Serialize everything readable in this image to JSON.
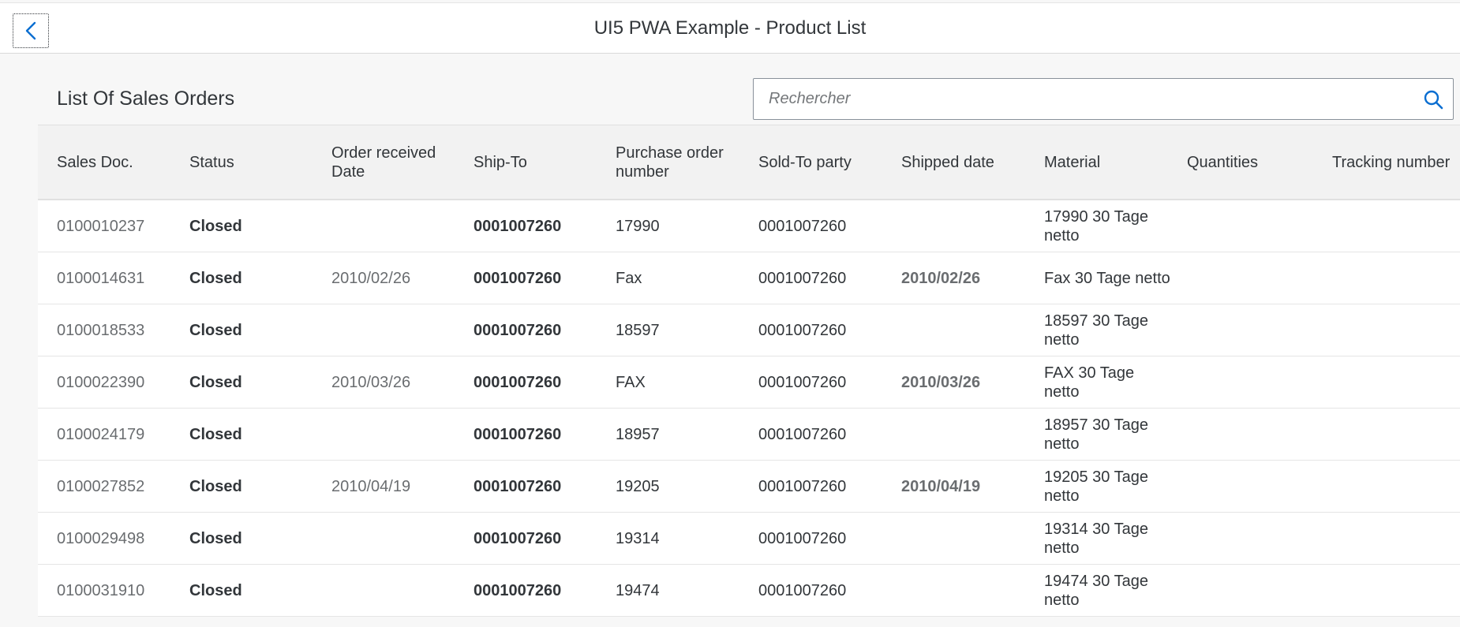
{
  "shell": {
    "title": "UI5 PWA Example - Product List",
    "back_icon": "chevron-left-icon"
  },
  "toolbar": {
    "title": "List Of Sales Orders",
    "search_placeholder": "Rechercher",
    "search_value": "",
    "search_icon": "search-icon"
  },
  "colors": {
    "accent": "#0a6ed1",
    "header_bg": "#f2f2f2",
    "page_bg": "#f7f7f7"
  },
  "table": {
    "columns": [
      "Sales Doc.",
      "Status",
      "Order received Date",
      "Ship-To",
      "Purchase order number",
      "Sold-To party",
      "Shipped date",
      "Material",
      "Quantities",
      "Tracking number"
    ],
    "rows": [
      {
        "sales_doc": "0100010237",
        "status": "Closed",
        "order_date": "",
        "ship_to": "0001007260",
        "po_number": "17990",
        "sold_to": "0001007260",
        "shipped_date": "",
        "material": "17990 30 Tage netto",
        "quantities": "",
        "tracking": ""
      },
      {
        "sales_doc": "0100014631",
        "status": "Closed",
        "order_date": "2010/02/26",
        "ship_to": "0001007260",
        "po_number": "Fax",
        "sold_to": "0001007260",
        "shipped_date": "2010/02/26",
        "material": "Fax 30 Tage netto",
        "quantities": "",
        "tracking": ""
      },
      {
        "sales_doc": "0100018533",
        "status": "Closed",
        "order_date": "",
        "ship_to": "0001007260",
        "po_number": "18597",
        "sold_to": "0001007260",
        "shipped_date": "",
        "material": "18597 30 Tage netto",
        "quantities": "",
        "tracking": ""
      },
      {
        "sales_doc": "0100022390",
        "status": "Closed",
        "order_date": "2010/03/26",
        "ship_to": "0001007260",
        "po_number": "FAX",
        "sold_to": "0001007260",
        "shipped_date": "2010/03/26",
        "material": "FAX 30 Tage netto",
        "quantities": "",
        "tracking": ""
      },
      {
        "sales_doc": "0100024179",
        "status": "Closed",
        "order_date": "",
        "ship_to": "0001007260",
        "po_number": "18957",
        "sold_to": "0001007260",
        "shipped_date": "",
        "material": "18957 30 Tage netto",
        "quantities": "",
        "tracking": ""
      },
      {
        "sales_doc": "0100027852",
        "status": "Closed",
        "order_date": "2010/04/19",
        "ship_to": "0001007260",
        "po_number": "19205",
        "sold_to": "0001007260",
        "shipped_date": "2010/04/19",
        "material": "19205 30 Tage netto",
        "quantities": "",
        "tracking": ""
      },
      {
        "sales_doc": "0100029498",
        "status": "Closed",
        "order_date": "",
        "ship_to": "0001007260",
        "po_number": "19314",
        "sold_to": "0001007260",
        "shipped_date": "",
        "material": "19314 30 Tage netto",
        "quantities": "",
        "tracking": ""
      },
      {
        "sales_doc": "0100031910",
        "status": "Closed",
        "order_date": "",
        "ship_to": "0001007260",
        "po_number": "19474",
        "sold_to": "0001007260",
        "shipped_date": "",
        "material": "19474 30 Tage netto",
        "quantities": "",
        "tracking": ""
      }
    ]
  }
}
